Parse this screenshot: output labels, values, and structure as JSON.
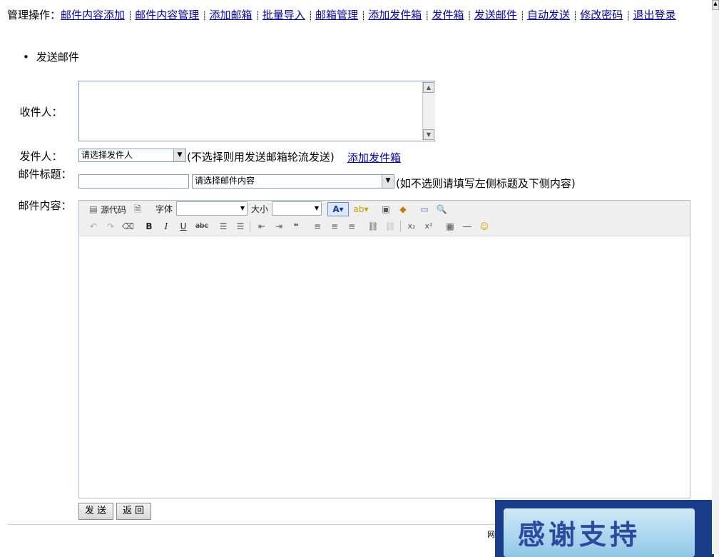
{
  "nav": {
    "prefix": "管理操作：",
    "links": [
      "邮件内容添加",
      "邮件内容管理",
      "添加邮箱",
      "批量导入",
      "邮箱管理",
      "添加发件箱",
      "发件箱",
      "发送邮件",
      "自动发送",
      "修改密码",
      "退出登录"
    ]
  },
  "section_title": "发送邮件",
  "form": {
    "recipient_label": "收件人：",
    "sender_label": "发件人：",
    "sender_select": "请选择发件人",
    "sender_hint": "(不选择则用发送邮箱轮流发送)",
    "add_sender_link": "添加发件箱",
    "subject_label": "邮件标题：",
    "subject_value": "",
    "content_select": "请选择邮件内容",
    "content_hint": "(如不选则请填写左侧标题及下侧内容)",
    "content_label": "邮件内容："
  },
  "toolbar": {
    "source": "源代码",
    "font_label": "字体",
    "size_label": "大小"
  },
  "buttons": {
    "send": "发送",
    "back": "返回"
  },
  "footer_fragment": "网",
  "banner": "感谢支持"
}
